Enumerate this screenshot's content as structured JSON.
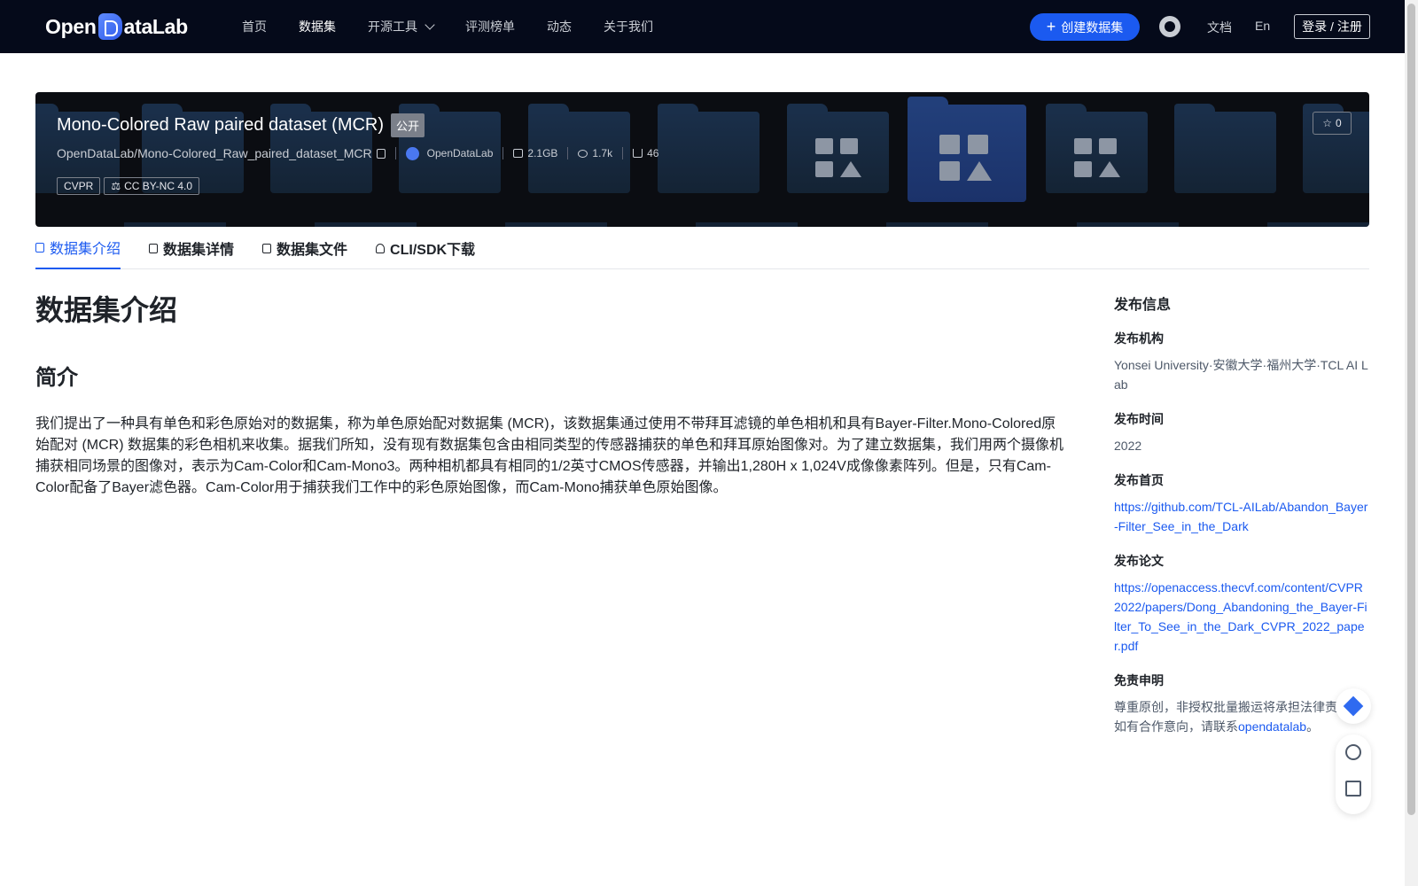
{
  "header": {
    "logo_text_left": "Open",
    "logo_text_right": "ataLab",
    "nav": [
      {
        "label": "首页"
      },
      {
        "label": "数据集"
      },
      {
        "label": "开源工具"
      },
      {
        "label": "评测榜单"
      },
      {
        "label": "动态"
      },
      {
        "label": "关于我们"
      }
    ],
    "create_label": "创建数据集",
    "docs_label": "文档",
    "lang_label": "En",
    "login_label": "登录 / 注册"
  },
  "banner": {
    "title": "Mono-Colored Raw paired dataset (MCR)",
    "visibility": "公开",
    "repo_path": "OpenDataLab/Mono-Colored_Raw_paired_dataset_MCR",
    "org": "OpenDataLab",
    "size": "2.1GB",
    "views": "1.7k",
    "downloads": "46",
    "tags": [
      "CVPR",
      "CC BY-NC 4.0"
    ],
    "star_count": "0"
  },
  "tabs": [
    {
      "label": "数据集介绍"
    },
    {
      "label": "数据集详情"
    },
    {
      "label": "数据集文件"
    },
    {
      "label": "CLI/SDK下载"
    }
  ],
  "main": {
    "title": "数据集介绍",
    "section": "简介",
    "body": "我们提出了一种具有单色和彩色原始对的数据集，称为单色原始配对数据集 (MCR)，该数据集通过使用不带拜耳滤镜的单色相机和具有Bayer-Filter.Mono-Colored原始配对 (MCR) 数据集的彩色相机来收集。据我们所知，没有现有数据集包含由相同类型的传感器捕获的单色和拜耳原始图像对。为了建立数据集，我们用两个摄像机捕获相同场景的图像对，表示为Cam-Color和Cam-Mono3。两种相机都具有相同的1/2英寸CMOS传感器，并输出1,280H x 1,024V成像像素阵列。但是，只有Cam-Color配备了Bayer滤色器。Cam-Color用于捕获我们工作中的彩色原始图像，而Cam-Mono捕获单色原始图像。"
  },
  "sidebar": {
    "title": "发布信息",
    "publisher_label": "发布机构",
    "publisher": "Yonsei University·安徽大学·福州大学·TCL AI Lab",
    "time_label": "发布时间",
    "time": "2022",
    "homepage_label": "发布首页",
    "homepage": "https://github.com/TCL-AILab/Abandon_Bayer-Filter_See_in_the_Dark",
    "paper_label": "发布论文",
    "paper": "https://openaccess.thecvf.com/content/CVPR2022/papers/Dong_Abandoning_the_Bayer-Filter_To_See_in_the_Dark_CVPR_2022_paper.pdf",
    "disclaimer_label": "免责申明",
    "disclaimer_text": "尊重原创，非授权批量搬运将承担法律责任。如有合作意向，请联系",
    "disclaimer_link": "opendatalab",
    "disclaimer_end": "。"
  },
  "colors": {
    "header_bg": "#050a1a",
    "accent": "#1b5af0",
    "banner_bg": "#0b0d12"
  }
}
